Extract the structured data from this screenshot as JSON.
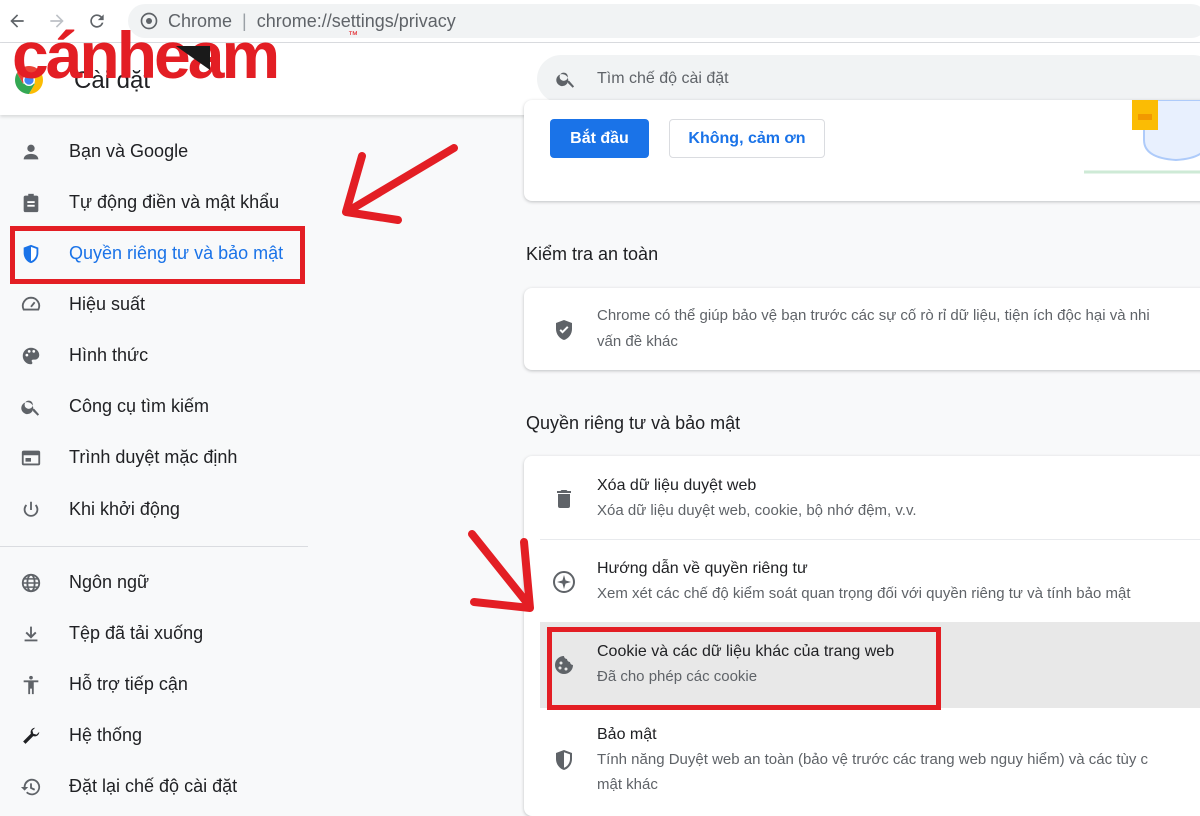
{
  "browser": {
    "site_name": "Chrome",
    "separator": "|",
    "url": "chrome://settings/privacy"
  },
  "header": {
    "title": "Cài đặt",
    "search_placeholder": "Tìm chế độ cài đặt"
  },
  "watermark": {
    "text": "cánheam",
    "tm": "™"
  },
  "sidebar": {
    "items": [
      {
        "label": "Bạn và Google",
        "icon": "person-icon"
      },
      {
        "label": "Tự động điền và mật khẩu",
        "icon": "clipboard-icon"
      },
      {
        "label": "Quyền riêng tư và bảo mật",
        "icon": "shield-icon",
        "active": true
      },
      {
        "label": "Hiệu suất",
        "icon": "speedometer-icon"
      },
      {
        "label": "Hình thức",
        "icon": "palette-icon"
      },
      {
        "label": "Công cụ tìm kiếm",
        "icon": "search-icon"
      },
      {
        "label": "Trình duyệt mặc định",
        "icon": "browser-window-icon"
      },
      {
        "label": "Khi khởi động",
        "icon": "power-icon"
      },
      {
        "label": "Ngôn ngữ",
        "icon": "globe-icon"
      },
      {
        "label": "Tệp đã tải xuống",
        "icon": "download-icon"
      },
      {
        "label": "Hỗ trợ tiếp cận",
        "icon": "accessibility-icon"
      },
      {
        "label": "Hệ thống",
        "icon": "wrench-icon"
      },
      {
        "label": "Đặt lại chế độ cài đặt",
        "icon": "restore-icon"
      }
    ]
  },
  "promo": {
    "start_label": "Bắt đầu",
    "dismiss_label": "Không, cảm ơn"
  },
  "safety_check": {
    "section_title": "Kiểm tra an toàn",
    "text_line1": "Chrome có thể giúp bảo vệ bạn trước các sự cố rò rỉ dữ liệu, tiện ích độc hại và nhi",
    "text_line2": "vấn đề khác"
  },
  "privacy": {
    "section_title": "Quyền riêng tư và bảo mật",
    "rows": [
      {
        "title": "Xóa dữ liệu duyệt web",
        "subtitle": "Xóa dữ liệu duyệt web, cookie, bộ nhớ đệm, v.v.",
        "icon": "trash-icon"
      },
      {
        "title": "Hướng dẫn về quyền riêng tư",
        "subtitle": "Xem xét các chế độ kiểm soát quan trọng đối với quyền riêng tư và tính bảo mật",
        "icon": "compass-icon"
      },
      {
        "title": "Cookie và các dữ liệu khác của trang web",
        "subtitle": "Đã cho phép các cookie",
        "icon": "cookie-icon"
      },
      {
        "title": "Bảo mật",
        "subtitle": "Tính năng Duyệt web an toàn (bảo vệ trước các trang web nguy hiểm) và các tùy c",
        "subtitle2": "mật khác",
        "icon": "shield-icon"
      }
    ]
  },
  "colors": {
    "accent": "#1a73e8",
    "highlight": "#e31e24",
    "text": "#202124",
    "secondary_text": "#5f6368"
  }
}
